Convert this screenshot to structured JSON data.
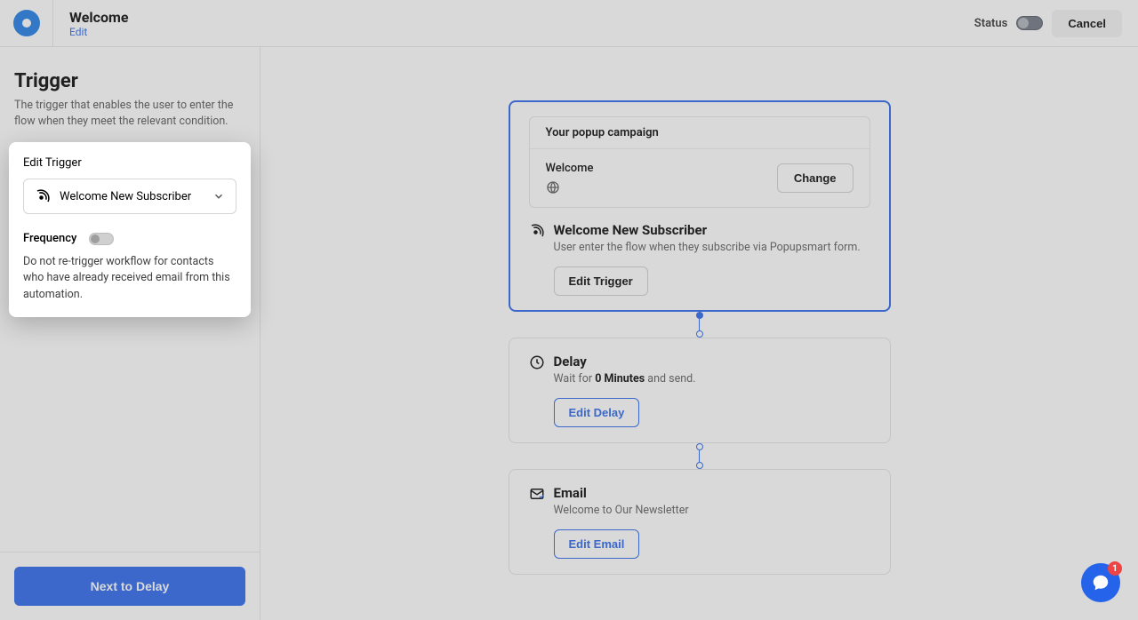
{
  "header": {
    "title": "Welcome",
    "edit_label": "Edit",
    "status_label": "Status",
    "cancel_label": "Cancel"
  },
  "sidebar": {
    "trigger_title": "Trigger",
    "trigger_desc": "The trigger that enables the user to enter the flow when they meet the relevant condition.",
    "card": {
      "label": "Edit Trigger",
      "selected": "Welcome New Subscriber",
      "frequency_label": "Frequency",
      "frequency_desc": "Do not re-trigger workflow for contacts who have already received email from this automation."
    },
    "next_button": "Next to Delay"
  },
  "flow": {
    "trigger_node": {
      "popup_title": "Your popup campaign",
      "popup_name": "Welcome",
      "change_label": "Change",
      "title": "Welcome New Subscriber",
      "desc": "User enter the flow when they subscribe via Popupsmart form.",
      "button": "Edit Trigger"
    },
    "delay_node": {
      "title": "Delay",
      "wait_prefix": "Wait for ",
      "wait_value": "0 Minutes",
      "wait_suffix": " and send.",
      "button": "Edit Delay"
    },
    "email_node": {
      "title": "Email",
      "subject": "Welcome to Our Newsletter",
      "button": "Edit Email"
    }
  },
  "chat": {
    "badge": "1"
  }
}
